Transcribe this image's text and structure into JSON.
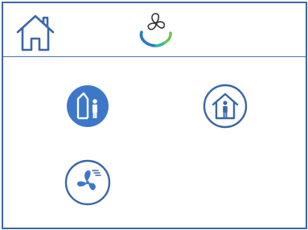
{
  "colors": {
    "border": "#3a67a8",
    "accent_blue": "#3d77c9",
    "icon_line": "#3a67a8",
    "logo_teal": "#2fb6a6",
    "logo_green": "#6fc25a",
    "logo_blue": "#2b78c8"
  },
  "header": {
    "home_icon": "home-outline-icon",
    "logo_icon": "fan-logo-icon"
  },
  "modes": [
    {
      "id": "away",
      "icon": "person-leaving-house-icon",
      "state": "selected"
    },
    {
      "id": "home",
      "icon": "person-in-house-icon",
      "state": "unselected"
    },
    {
      "id": "boost",
      "icon": "fan-boost-icon",
      "state": "unselected"
    }
  ]
}
